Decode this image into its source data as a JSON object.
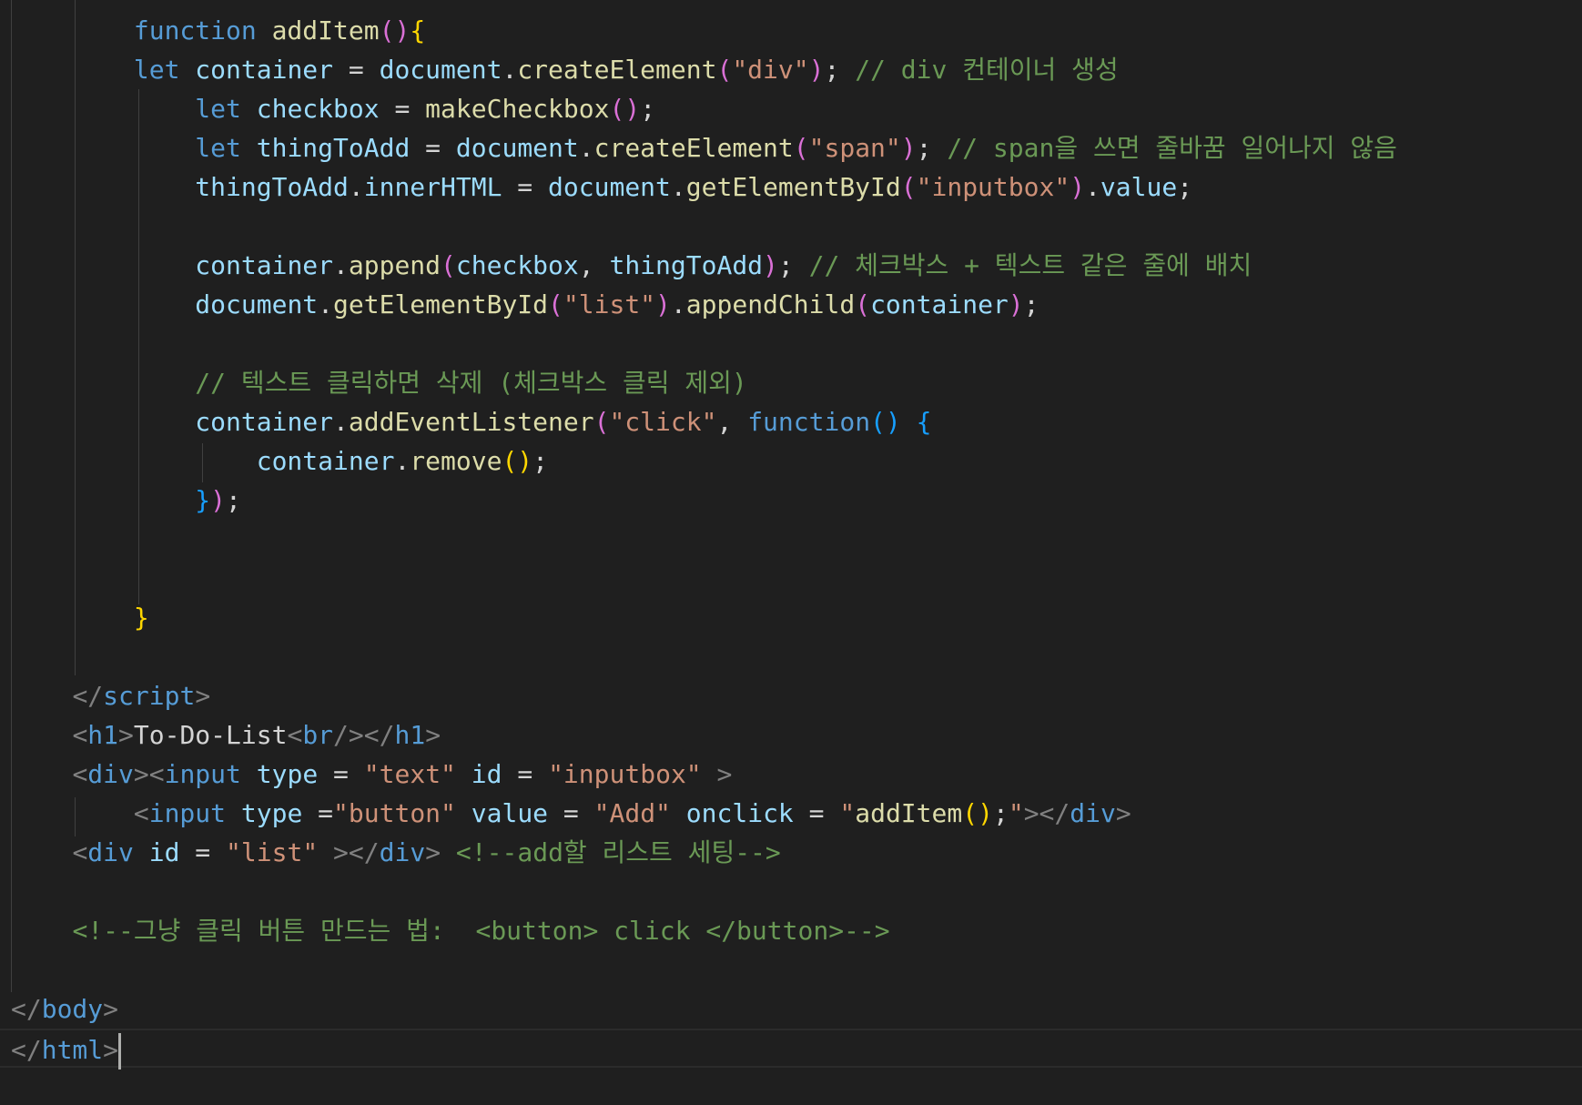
{
  "editor": {
    "theme_colors": {
      "background": "#1f1f1f",
      "keyword": "#569cd6",
      "function": "#dcdcaa",
      "variable": "#9cdcfe",
      "string": "#ce9178",
      "comment": "#6a9955",
      "bracket_gold": "#ffd700",
      "bracket_purple": "#da70d6",
      "bracket_blue": "#179fff"
    },
    "code": {
      "l1": {
        "kw": "function",
        "fn": "addItem"
      },
      "l2": {
        "kw": "let",
        "var1": "container",
        "var2": "document",
        "fn": "createElement",
        "str": "\"div\"",
        "cm": "// div 컨테이너 생성"
      },
      "l3": {
        "kw": "let",
        "var1": "checkbox",
        "fn": "makeCheckbox"
      },
      "l4": {
        "kw": "let",
        "var1": "thingToAdd",
        "var2": "document",
        "fn": "createElement",
        "str": "\"span\"",
        "cm": "// span을 쓰면 줄바꿈 일어나지 않음"
      },
      "l5": {
        "var1": "thingToAdd",
        "var2": "innerHTML",
        "var3": "document",
        "fn": "getElementById",
        "str": "\"inputbox\"",
        "var4": "value"
      },
      "l7": {
        "var1": "container",
        "fn": "append",
        "var2": "checkbox",
        "var3": "thingToAdd",
        "cm": "// 체크박스 + 텍스트 같은 줄에 배치"
      },
      "l8": {
        "var1": "document",
        "fn1": "getElementById",
        "str": "\"list\"",
        "fn2": "appendChild",
        "var2": "container"
      },
      "l10": {
        "cm": "// 텍스트 클릭하면 삭제 (체크박스 클릭 제외)"
      },
      "l11": {
        "var1": "container",
        "fn": "addEventListener",
        "str": "\"click\"",
        "kw": "function"
      },
      "l12": {
        "var1": "container",
        "fn": "remove"
      },
      "l18": {
        "tag": "script"
      },
      "l19": {
        "tag1": "h1",
        "text": "To-Do-List",
        "tag2": "br",
        "tag3": "h1"
      },
      "l20": {
        "tag1": "div",
        "tag2": "input",
        "attr1": "type",
        "str1": "\"text\"",
        "attr2": "id",
        "str2": "\"inputbox\""
      },
      "l21": {
        "tag1": "input",
        "attr1": "type",
        "str1": "\"button\"",
        "attr2": "value",
        "str2": "\"Add\"",
        "attr3": "onclick",
        "str3a": "\"",
        "fn": "addItem",
        "str3b": "\"",
        "tag2": "div"
      },
      "l22": {
        "tag1": "div",
        "attr1": "id",
        "str1": "\"list\"",
        "tag2": "div",
        "cm": "<!--add할 리스트 세팅-->"
      },
      "l24": {
        "cm": "<!--그냥 클릭 버튼 만드는 법:  <button> click </button>-->"
      },
      "l26": {
        "tag": "body"
      },
      "l27": {
        "tag": "html"
      }
    }
  }
}
